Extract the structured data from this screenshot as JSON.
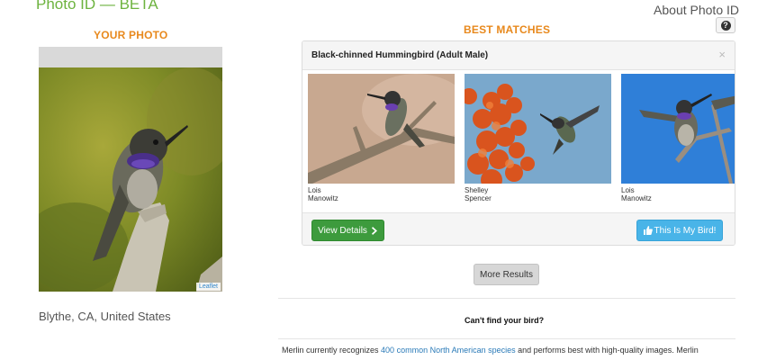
{
  "header": {
    "title": "Photo ID — BETA",
    "about_link": "About Photo ID",
    "help_icon": "question-circle-icon"
  },
  "your_photo": {
    "heading": "YOUR PHOTO",
    "attribution": "Leaflet",
    "location": "Blythe, CA, United States"
  },
  "best_matches": {
    "heading": "BEST MATCHES",
    "match_title": "Black-chinned Hummingbird (Adult Male)",
    "close_symbol": "×",
    "photos": [
      {
        "credit": "Lois Manowitz"
      },
      {
        "credit": "Shelley Spencer"
      },
      {
        "credit": "Lois Manowitz"
      }
    ],
    "view_details_label": "View Details",
    "my_bird_label": "This Is My Bird!",
    "more_results_label": "More Results"
  },
  "help_section": {
    "cant_find": "Can't find your bird?",
    "text_before": "Merlin currently recognizes ",
    "link_text": "400 common North American species",
    "text_after": " and performs best with high-quality images. Merlin"
  },
  "colors": {
    "brand_green": "#6db33f",
    "heading_orange": "#e8891d",
    "details_green": "#3d9b3d",
    "my_bird_blue": "#49b4e8",
    "link_blue": "#2a7ab8"
  }
}
